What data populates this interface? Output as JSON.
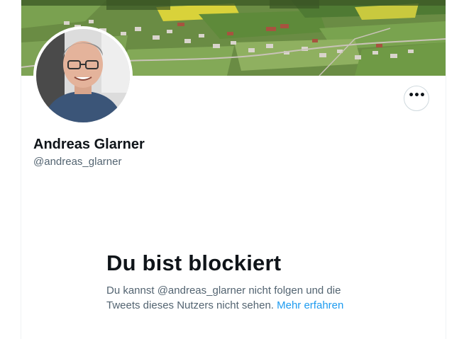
{
  "profile": {
    "display_name": "Andreas Glarner",
    "handle": "@andreas_glarner",
    "banner_image": "village-landscape-photo",
    "avatar_image": "profile-photo"
  },
  "actions": {
    "more_icon": "ellipsis-horizontal-icon",
    "more_label": "•••"
  },
  "blocked": {
    "title": "Du bist blockiert",
    "message": "Du kannst @andreas_glarner nicht folgen und die Tweets dieses Nutzers nicht sehen.",
    "link_label": "Mehr erfahren"
  },
  "colors": {
    "accent": "#1d9bf0",
    "text_primary": "#0f1419",
    "text_secondary": "#536471",
    "border": "#cfd9de"
  }
}
